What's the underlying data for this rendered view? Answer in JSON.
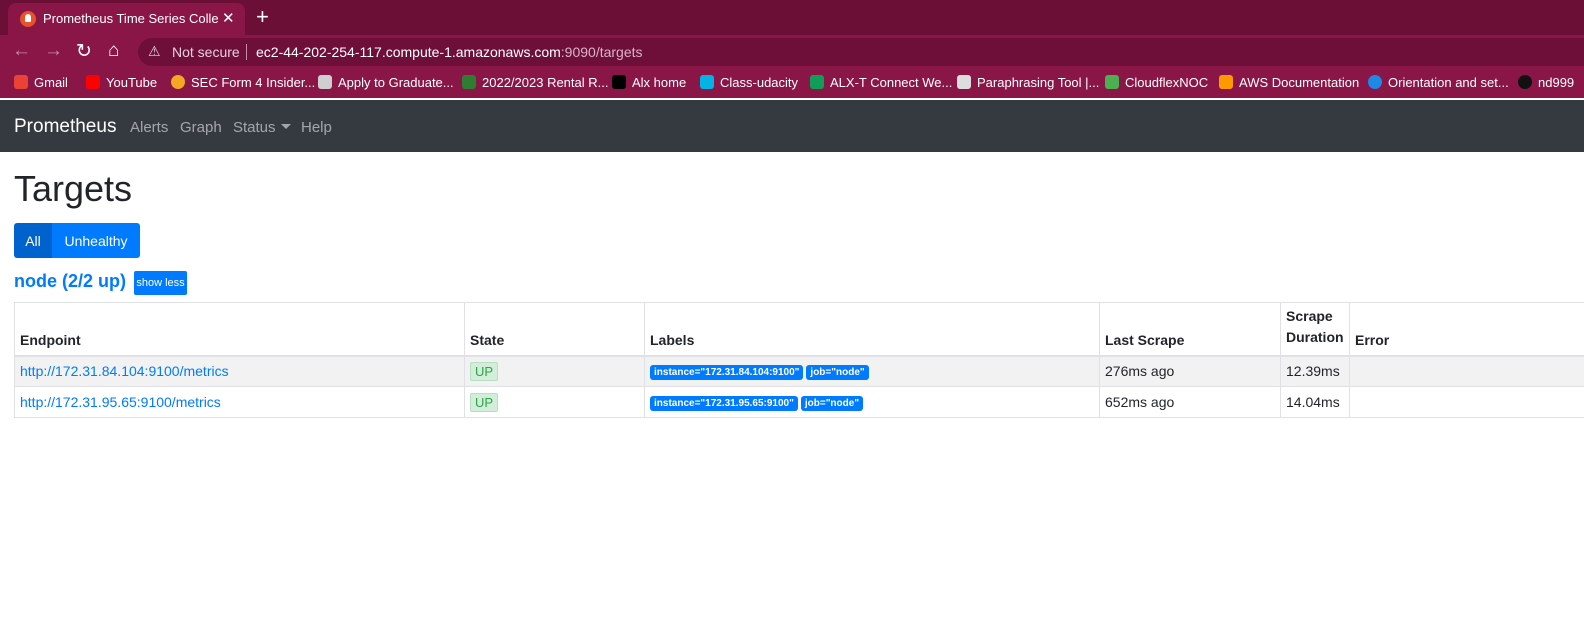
{
  "browser": {
    "tab_title": "Prometheus Time Series Collection",
    "not_secure": "Not secure",
    "url_host": "ec2-44-202-254-117.compute-1.amazonaws.com",
    "url_rest": ":9090/targets",
    "bookmarks": [
      "Gmail",
      "YouTube",
      "SEC Form 4 Insider...",
      "Apply to Graduate...",
      "2022/2023 Rental R...",
      "Alx home",
      "Class-udacity",
      "ALX-T Connect We...",
      "Paraphrasing Tool |...",
      "CloudflexNOC",
      "AWS Documentation",
      "Orientation and set...",
      "nd999"
    ]
  },
  "navbar": {
    "brand": "Prometheus",
    "links": [
      "Alerts",
      "Graph",
      "Status",
      "Help"
    ]
  },
  "page": {
    "title": "Targets",
    "filter_all": "All",
    "filter_unhealthy": "Unhealthy",
    "pool_title": "node (2/2 up)",
    "show_less": "show less"
  },
  "table": {
    "headers": [
      "Endpoint",
      "State",
      "Labels",
      "Last Scrape",
      "Scrape Duration",
      "Error"
    ],
    "rows": [
      {
        "endpoint": "http://172.31.84.104:9100/metrics",
        "state": "UP",
        "label_instance": "instance=\"172.31.84.104:9100\"",
        "label_job": "job=\"node\"",
        "last_scrape": "276ms ago",
        "duration": "12.39ms",
        "error": ""
      },
      {
        "endpoint": "http://172.31.95.65:9100/metrics",
        "state": "UP",
        "label_instance": "instance=\"172.31.95.65:9100\"",
        "label_job": "job=\"node\"",
        "last_scrape": "652ms ago",
        "duration": "14.04ms",
        "error": ""
      }
    ]
  },
  "colors": {
    "browser_tabbar": "#6b0f36",
    "browser_toolbar": "#8a1648",
    "navbar": "#343a40",
    "primary": "#007bff",
    "up_green": "#28a745"
  }
}
